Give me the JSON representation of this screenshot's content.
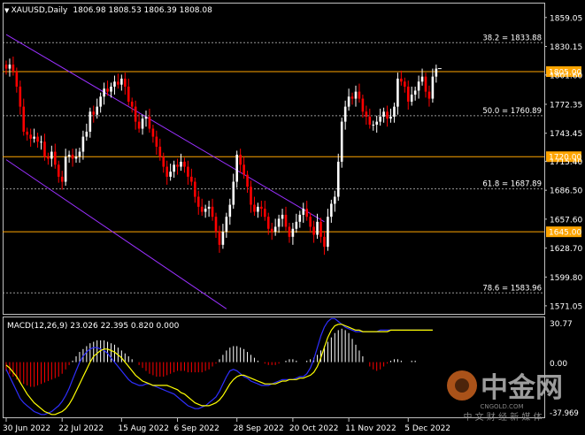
{
  "header": {
    "symbol": "XAUUSD,Daily",
    "ohlc": "1806.98 1808.53 1806.39 1808.08"
  },
  "macd": {
    "label": "MACD(12,26,9) 23.026 22.395 0.820 0.000",
    "scale_top": "30.77",
    "scale_zero": "0.00",
    "scale_bottom": "-37.969"
  },
  "colors": {
    "bg": "#000000",
    "up": "#ffffff",
    "down": "#ff0000",
    "level_line": "#ffa500",
    "channel": "#9a30ff",
    "fib_line": "#c0c0c0",
    "signal": "#ffff00",
    "macd_line": "#2f2fff"
  },
  "watermark": {
    "text": "中金网",
    "domain": "CNGOLD.COM",
    "sub": "中 文 财 经 新 媒 体"
  },
  "chart_data": {
    "type": "candlestick",
    "title": "XAUUSD,Daily",
    "ylim": [
      1563,
      1873
    ],
    "y_ticks": [
      "1859.05",
      "1830.15",
      "1801.60",
      "1772.35",
      "1743.45",
      "1715.40",
      "1686.50",
      "1657.60",
      "1628.70",
      "1599.80",
      "1571.05"
    ],
    "x_ticks": [
      "30 Jun 2022",
      "22 Jul 2022",
      "15 Aug 2022",
      "6 Sep 2022",
      "28 Sep 2022",
      "20 Oct 2022",
      "11 Nov 2022",
      "5 Dec 2022"
    ],
    "x_tick_index": [
      0,
      16,
      33,
      49,
      66,
      82,
      98,
      115
    ],
    "levels": [
      {
        "label": "1805.00",
        "value": 1805.0
      },
      {
        "label": "1720.00",
        "value": 1720.0
      },
      {
        "label": "1645.00",
        "value": 1645.0
      }
    ],
    "fibonacci": [
      {
        "label": "38.2 = 1833.88",
        "value": 1833.88
      },
      {
        "label": "50.0 = 1760.89",
        "value": 1760.89
      },
      {
        "label": "61.8 = 1687.89",
        "value": 1687.89
      },
      {
        "label": "78.6 = 1583.96",
        "value": 1583.96
      }
    ],
    "channel": [
      {
        "from_index": 0,
        "from_value": 1842,
        "to_index": 91,
        "to_value": 1655
      },
      {
        "from_index": 0,
        "from_value": 1717,
        "to_index": 63,
        "to_value": 1568
      }
    ],
    "closes": [
      1808,
      1812,
      1805,
      1790,
      1770,
      1745,
      1742,
      1738,
      1740,
      1735,
      1735,
      1720,
      1718,
      1725,
      1712,
      1700,
      1695,
      1720,
      1722,
      1718,
      1720,
      1725,
      1740,
      1745,
      1765,
      1762,
      1770,
      1780,
      1788,
      1785,
      1790,
      1795,
      1792,
      1798,
      1790,
      1775,
      1770,
      1755,
      1748,
      1758,
      1760,
      1748,
      1740,
      1730,
      1720,
      1710,
      1700,
      1705,
      1712,
      1710,
      1715,
      1710,
      1700,
      1695,
      1680,
      1670,
      1665,
      1668,
      1670,
      1660,
      1645,
      1632,
      1645,
      1660,
      1672,
      1695,
      1722,
      1712,
      1702,
      1690,
      1672,
      1665,
      1670,
      1668,
      1660,
      1648,
      1645,
      1650,
      1658,
      1662,
      1650,
      1640,
      1648,
      1655,
      1662,
      1668,
      1660,
      1650,
      1642,
      1655,
      1640,
      1630,
      1660,
      1673,
      1680,
      1715,
      1755,
      1770,
      1780,
      1778,
      1785,
      1778,
      1765,
      1760,
      1752,
      1752,
      1755,
      1760,
      1765,
      1758,
      1760,
      1770,
      1798,
      1795,
      1790,
      1775,
      1782,
      1786,
      1795,
      1800,
      1785,
      1778,
      1800,
      1808
    ],
    "macd": {
      "histogram": [
        -6,
        -8,
        -10,
        -12,
        -14,
        -15,
        -16,
        -17,
        -17,
        -16,
        -15,
        -14,
        -13,
        -12,
        -11,
        -10,
        -8,
        -5,
        -2,
        1,
        4,
        7,
        9,
        11,
        13,
        14,
        15,
        15,
        15,
        14,
        13,
        12,
        10,
        8,
        6,
        4,
        2,
        0,
        -2,
        -4,
        -6,
        -8,
        -9,
        -10,
        -10,
        -10,
        -9,
        -8,
        -7,
        -6,
        -6,
        -6,
        -7,
        -7,
        -7,
        -7,
        -7,
        -6,
        -5,
        -3,
        -1,
        2,
        5,
        8,
        10,
        11,
        11,
        10,
        9,
        7,
        5,
        3,
        1,
        0,
        -1,
        -2,
        -2,
        -2,
        -1,
        0,
        1,
        2,
        2,
        1,
        0,
        0,
        1,
        2,
        3,
        5,
        8,
        11,
        14,
        17,
        20,
        22,
        23,
        22,
        20,
        16,
        12,
        8,
        4,
        0,
        -3,
        -5,
        -6,
        -5,
        -3,
        -1,
        1,
        2,
        2,
        1,
        0,
        0,
        1,
        1,
        0,
        0,
        0,
        0,
        0
      ],
      "macd_line": [
        -5,
        -10,
        -15,
        -20,
        -25,
        -28,
        -30,
        -32,
        -34,
        -35,
        -36,
        -36,
        -35,
        -34,
        -32,
        -30,
        -27,
        -23,
        -18,
        -12,
        -6,
        0,
        4,
        7,
        9,
        10,
        10,
        9,
        8,
        6,
        3,
        0,
        -3,
        -6,
        -9,
        -12,
        -14,
        -15,
        -16,
        -16,
        -15,
        -15,
        -16,
        -17,
        -18,
        -19,
        -20,
        -21,
        -22,
        -24,
        -26,
        -28,
        -30,
        -31,
        -32,
        -32,
        -31,
        -30,
        -28,
        -26,
        -24,
        -20,
        -15,
        -10,
        -6,
        -5,
        -6,
        -8,
        -10,
        -11,
        -13,
        -14,
        -15,
        -16,
        -16,
        -16,
        -15,
        -14,
        -13,
        -12,
        -12,
        -12,
        -12,
        -11,
        -10,
        -10,
        -8,
        -4,
        2,
        10,
        18,
        24,
        28,
        30,
        30,
        28,
        26,
        24,
        23,
        22,
        21,
        21,
        21,
        21,
        21,
        21,
        21,
        22,
        22,
        22,
        22,
        22,
        22,
        22,
        22,
        22,
        22,
        22,
        22,
        22,
        22,
        22,
        22
      ],
      "signal_line": [
        -2,
        -4,
        -7,
        -10,
        -14,
        -18,
        -22,
        -25,
        -28,
        -30,
        -32,
        -34,
        -35,
        -36,
        -36,
        -35,
        -34,
        -32,
        -29,
        -25,
        -20,
        -15,
        -10,
        -5,
        0,
        4,
        6,
        8,
        9,
        9,
        8,
        7,
        5,
        3,
        0,
        -3,
        -6,
        -9,
        -11,
        -13,
        -14,
        -15,
        -16,
        -16,
        -16,
        -16,
        -16,
        -17,
        -18,
        -19,
        -21,
        -22,
        -24,
        -26,
        -28,
        -29,
        -30,
        -30,
        -30,
        -29,
        -28,
        -26,
        -23,
        -19,
        -15,
        -12,
        -10,
        -9,
        -9,
        -10,
        -11,
        -12,
        -13,
        -14,
        -15,
        -15,
        -15,
        -15,
        -14,
        -13,
        -13,
        -12,
        -12,
        -12,
        -11,
        -11,
        -10,
        -9,
        -7,
        -3,
        3,
        10,
        17,
        22,
        25,
        26,
        26,
        25,
        24,
        23,
        22,
        22,
        21,
        21,
        21,
        21,
        21,
        21,
        21,
        21,
        22,
        22,
        22,
        22,
        22,
        22,
        22,
        22,
        22,
        22,
        22,
        22,
        22
      ]
    }
  }
}
